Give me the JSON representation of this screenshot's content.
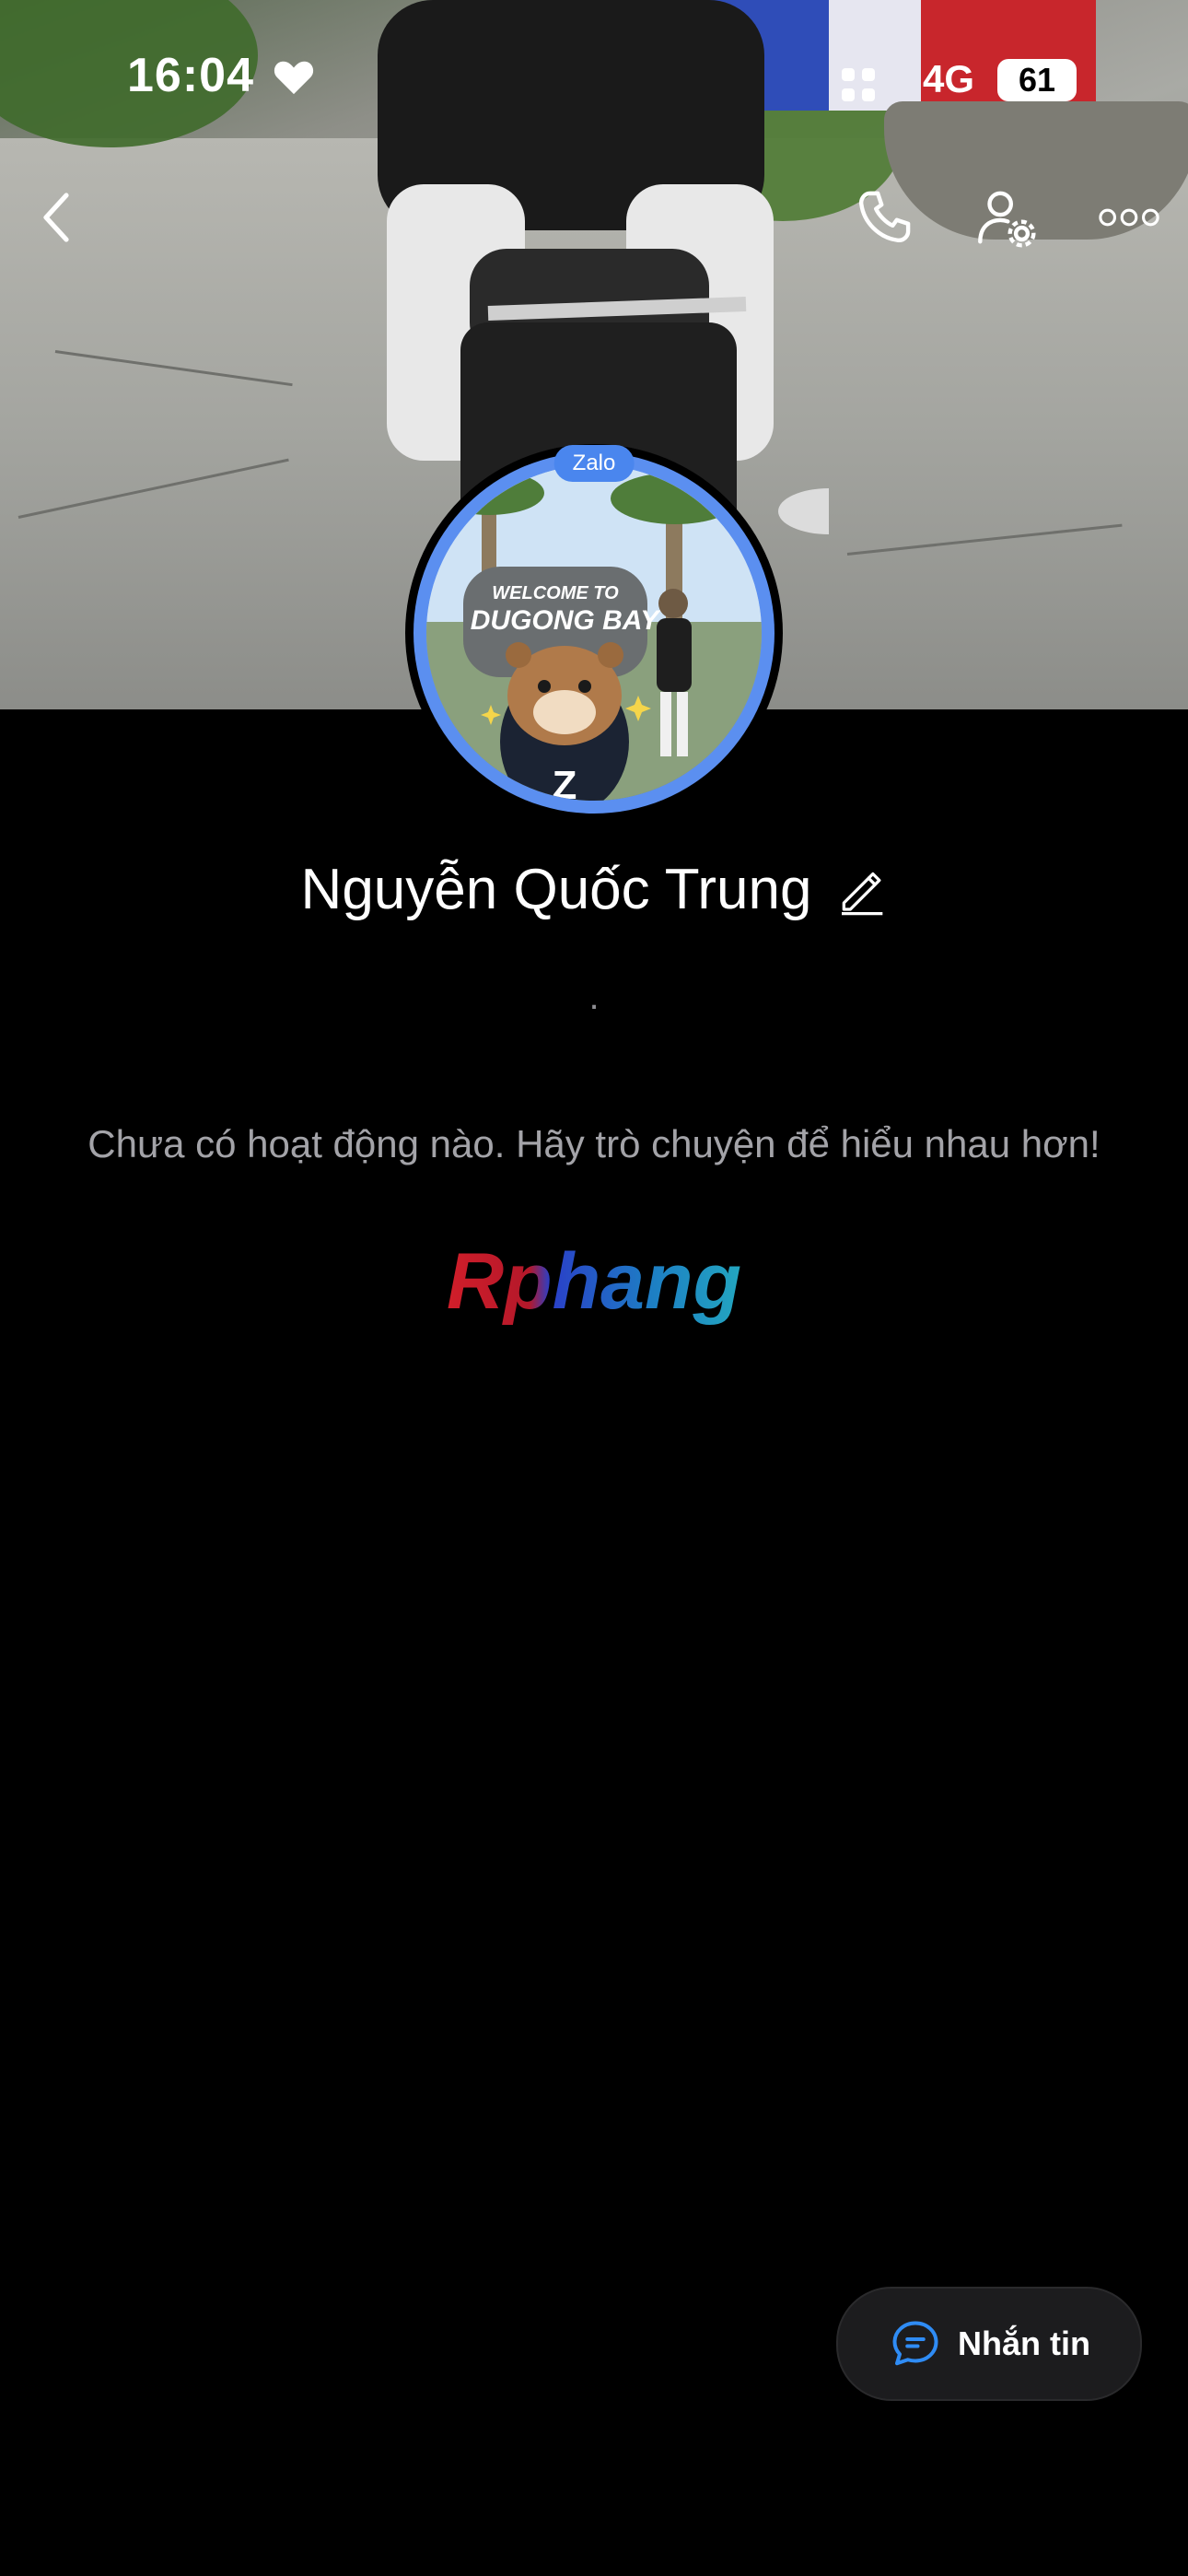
{
  "status_bar": {
    "time": "16:04",
    "network": "4G",
    "battery": "61"
  },
  "header_actions": {
    "back": "back-icon",
    "call": "phone-icon",
    "settings": "user-settings-icon",
    "more": "more-icon"
  },
  "profile": {
    "avatar_badge": "Zalo",
    "name": "Nguyễn Quốc Trung",
    "separator": ".",
    "empty_state": "Chưa có hoạt động nào. Hãy trò chuyện để hiểu nhau hơn!",
    "logo_text": "Rphang"
  },
  "avatar_sign": {
    "line1": "WELCOME TO",
    "line2": "DUGONG BAY"
  },
  "message_button": {
    "label": "Nhắn tin"
  },
  "colors": {
    "accent": "#4a86ee",
    "background": "#000000",
    "button_bg": "#1c1c1e"
  }
}
